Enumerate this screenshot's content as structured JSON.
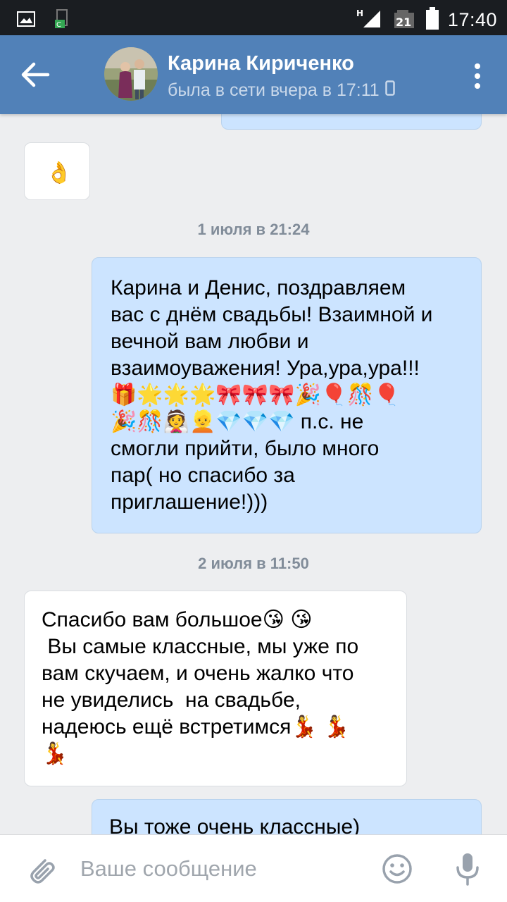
{
  "status_bar": {
    "time": "17:40",
    "network": "H",
    "battery_level": "21",
    "icons": [
      "gallery-icon",
      "cpu-icon",
      "signal-icon",
      "battery-icon"
    ]
  },
  "header": {
    "contact_name": "Карина Кириченко",
    "last_seen": "была в сети вчера в 17:11",
    "accent_color": "#5181b8"
  },
  "messages": [
    {
      "direction": "in",
      "text": "👌"
    },
    {
      "type": "date",
      "text": "1 июля в 21:24"
    },
    {
      "direction": "out",
      "lines": [
        "Карина и Денис, поздравляем",
        "вас с днём свадьбы! Взаимной и",
        "вечной вам любви и",
        "взаимоуважения! Ура,ура,ура!!!",
        "🎁🌟🌟🌟🎀🎀🎀🎉🎈🎊🎈",
        "🎉🎊👰👱💎💎💎 п.с. не",
        "смогли прийти, было много",
        "пар( но спасибо за",
        "приглашение!)))"
      ]
    },
    {
      "type": "date",
      "text": "2 июля в 11:50"
    },
    {
      "direction": "in",
      "lines": [
        "Спасибо вам большое😘 😘",
        " Вы самые классные, мы уже по",
        "вам скучаем, и очень жалко что",
        "не увиделись  на свадьбе,",
        "надеюсь ещё встретимся💃 💃",
        "💃"
      ]
    },
    {
      "direction": "out",
      "lines": [
        "Вы тоже очень классные)"
      ]
    }
  ],
  "composer": {
    "placeholder": "Ваше сообщение"
  }
}
